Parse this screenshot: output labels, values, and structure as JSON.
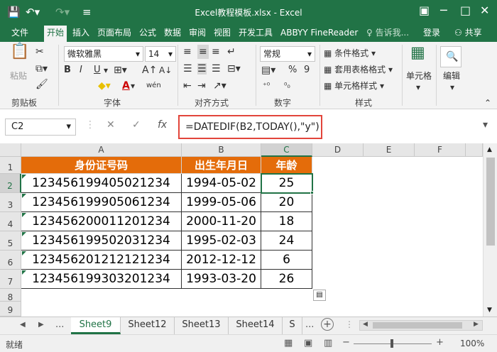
{
  "window": {
    "title": "Excel教程模板.xlsx - Excel",
    "save_icon": "save-icon",
    "undo_icon": "undo-icon",
    "redo_icon": "redo-icon",
    "customize_icon": "customize-icon"
  },
  "ribbon_tabs": [
    "文件",
    "开始",
    "插入",
    "页面布局",
    "公式",
    "数据",
    "审阅",
    "视图",
    "开发工具",
    "ABBYY FineReader",
    "♀ 告诉我...",
    "登录",
    "共享"
  ],
  "ribbon": {
    "clipboard": {
      "label": "剪贴板",
      "paste": "粘贴"
    },
    "font": {
      "label": "字体",
      "name": "微软雅黑",
      "size": "14",
      "bold": "B",
      "italic": "I",
      "underline": "U",
      "font_color_a": "A",
      "wen": "wén"
    },
    "alignment": {
      "label": "对齐方式"
    },
    "number": {
      "label": "数字",
      "format": "常规",
      "percent": "%",
      "comma": "9"
    },
    "styles": {
      "label": "样式",
      "conditional": "条件格式 ▾",
      "table": "套用表格格式 ▾",
      "cell": "单元格样式 ▾"
    },
    "cells": {
      "label": "单元格"
    },
    "editing": {
      "label": "编辑"
    }
  },
  "formula_bar": {
    "name_box": "C2",
    "cancel": "✕",
    "enter": "✓",
    "fx": "fx",
    "formula": "=DATEDIF(B2,TODAY(),\"y\")"
  },
  "columns": [
    "A",
    "B",
    "C",
    "D",
    "E",
    "F"
  ],
  "rows": [
    "1",
    "2",
    "3",
    "4",
    "5",
    "6",
    "7",
    "8",
    "9"
  ],
  "table": {
    "headers": [
      "身份证号码",
      "出生年月日",
      "年龄"
    ],
    "data": [
      [
        "123456199405021234",
        "1994-05-02",
        "25"
      ],
      [
        "123456199905061234",
        "1999-05-06",
        "20"
      ],
      [
        "123456200011201234",
        "2000-11-20",
        "18"
      ],
      [
        "123456199502031234",
        "1995-02-03",
        "24"
      ],
      [
        "123456201212121234",
        "2012-12-12",
        "6"
      ],
      [
        "123456199303201234",
        "1993-03-20",
        "26"
      ]
    ]
  },
  "sheets": [
    "Sheet9",
    "Sheet12",
    "Sheet13",
    "Sheet14",
    "S"
  ],
  "active_sheet": "Sheet9",
  "status": {
    "ready": "就绪",
    "zoom": "100%"
  },
  "colors": {
    "excel_green": "#217346",
    "header_orange": "#e46c0a",
    "highlight_red": "#e2453b"
  }
}
